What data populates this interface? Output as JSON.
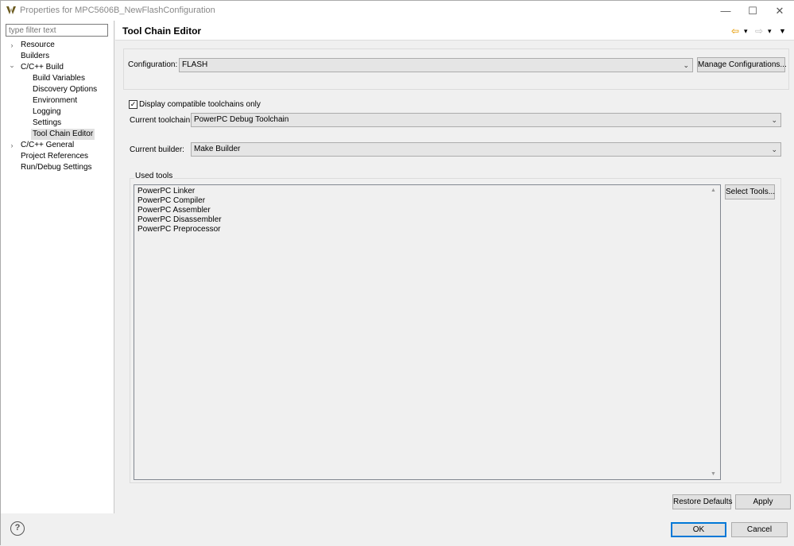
{
  "window": {
    "title": "Properties for MPC5606B_NewFlashConfiguration",
    "min_glyph": "—",
    "max_glyph": "☐",
    "close_glyph": "✕"
  },
  "filter": {
    "placeholder": "type filter text"
  },
  "tree": {
    "items": [
      {
        "label": "Resource",
        "twisty": "›"
      },
      {
        "label": "Builders",
        "twisty": ""
      },
      {
        "label": "C/C++ Build",
        "twisty": "⌄"
      },
      {
        "label": "Build Variables",
        "twisty": ""
      },
      {
        "label": "Discovery Options",
        "twisty": ""
      },
      {
        "label": "Environment",
        "twisty": ""
      },
      {
        "label": "Logging",
        "twisty": ""
      },
      {
        "label": "Settings",
        "twisty": ""
      },
      {
        "label": "Tool Chain Editor",
        "twisty": ""
      },
      {
        "label": "C/C++ General",
        "twisty": "›"
      },
      {
        "label": "Project References",
        "twisty": ""
      },
      {
        "label": "Run/Debug Settings",
        "twisty": ""
      }
    ]
  },
  "page": {
    "title": "Tool Chain Editor",
    "nav": {
      "back_glyph": "⇦",
      "forward_glyph": "⇨",
      "dropdown_glyph": "▾",
      "menu_glyph": "▼"
    }
  },
  "config": {
    "label": "Configuration:",
    "value": "FLASH",
    "manage_button": "Manage Configurations..."
  },
  "toolchain": {
    "compat_label": "Display compatible toolchains only",
    "compat_checked": true,
    "current_toolchain_label": "Current toolchain:",
    "current_toolchain_value": "PowerPC Debug Toolchain",
    "current_builder_label": "Current builder:",
    "current_builder_value": "Make Builder"
  },
  "used_tools": {
    "legend": "Used tools",
    "items": [
      "PowerPC Linker",
      "PowerPC Compiler",
      "PowerPC Assembler",
      "PowerPC Disassembler",
      "PowerPC Preprocessor"
    ],
    "select_button": "Select Tools..."
  },
  "actions": {
    "restore_defaults": "Restore Defaults",
    "apply": "Apply",
    "ok": "OK",
    "cancel": "Cancel"
  },
  "colors": {
    "accent": "#0078d7",
    "selection": "#e0e0e0",
    "back_arrow": "#e8a317"
  },
  "chevron": "⌄",
  "checkmark": "✓",
  "scroll_up": "▲",
  "scroll_down": "▼",
  "help_glyph": "?"
}
